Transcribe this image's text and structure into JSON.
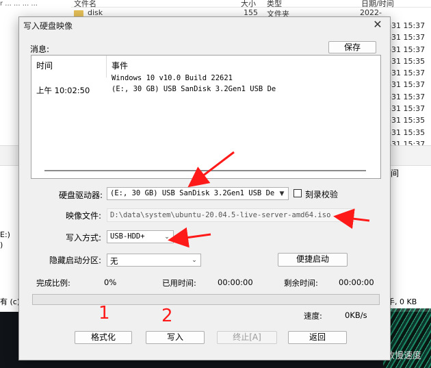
{
  "background": {
    "left_strip_text": "r ... ... ... ...",
    "header": {
      "name_col": "文件名",
      "size_col": "大小",
      "type_col": "类型",
      "date_col": "日期/时间"
    },
    "file_row": {
      "name": "disk",
      "size": "155",
      "type": "文件夹",
      "date": "2022-08-31 15:37"
    },
    "dates": [
      "-31 15:37",
      "-31 15:37",
      "-31 15:37",
      "-31 15:35",
      "-31 15:37",
      "-31 15:37",
      "-31 15:37",
      "-31 15:37",
      "-31 15:35",
      "-31 15:35",
      "-31 15:37",
      "-31 15:35"
    ],
    "right_label": "间",
    "left_labels": [
      "E:)",
      ")"
    ],
    "status_left": "有 (c)",
    "status_right": "手, 0 KB",
    "watermark": "CSDN @放慢速度"
  },
  "dialog": {
    "title": "写入硬盘映像",
    "close_glyph": "✕",
    "messages_label": "消息:",
    "save_button": "保存",
    "message_list": {
      "col_time": "时间",
      "col_event": "事件",
      "rows": [
        {
          "time": "",
          "event": "Windows 10 v10.0 Build 22621"
        },
        {
          "time": "上午 10:02:50",
          "event": "(E:, 30 GB) USB  SanDisk 3.2Gen1 USB De"
        }
      ]
    },
    "drive_label": "硬盘驱动器:",
    "drive_value": "(E:, 30 GB) USB  SanDisk 3.2Gen1 USB De",
    "verify_label": "刻录校验",
    "image_label": "映像文件:",
    "image_value": "D:\\data\\system\\ubuntu-20.04.5-live-server-amd64.iso",
    "write_method_label": "写入方式:",
    "write_method_value": "USB-HDD+",
    "hidden_partition_label": "隐藏启动分区:",
    "hidden_partition_value": "无",
    "convenient_boot_button": "便捷启动",
    "completion_label": "完成比例:",
    "completion_value": "0%",
    "elapsed_label": "已用时间:",
    "elapsed_value": "00:00:00",
    "remaining_label": "剩余时间:",
    "remaining_value": "00:00:00",
    "progress_fraction": 0,
    "speed_label": "速度:",
    "speed_value": "0KB/s",
    "format_button": "格式化",
    "write_button": "写入",
    "stop_button": "终止[A]",
    "return_button": "返回",
    "annotation_1": "1",
    "annotation_2": "2"
  },
  "colors": {
    "annotation_red": "#ff1a1a",
    "progress_green": "#06b025"
  }
}
